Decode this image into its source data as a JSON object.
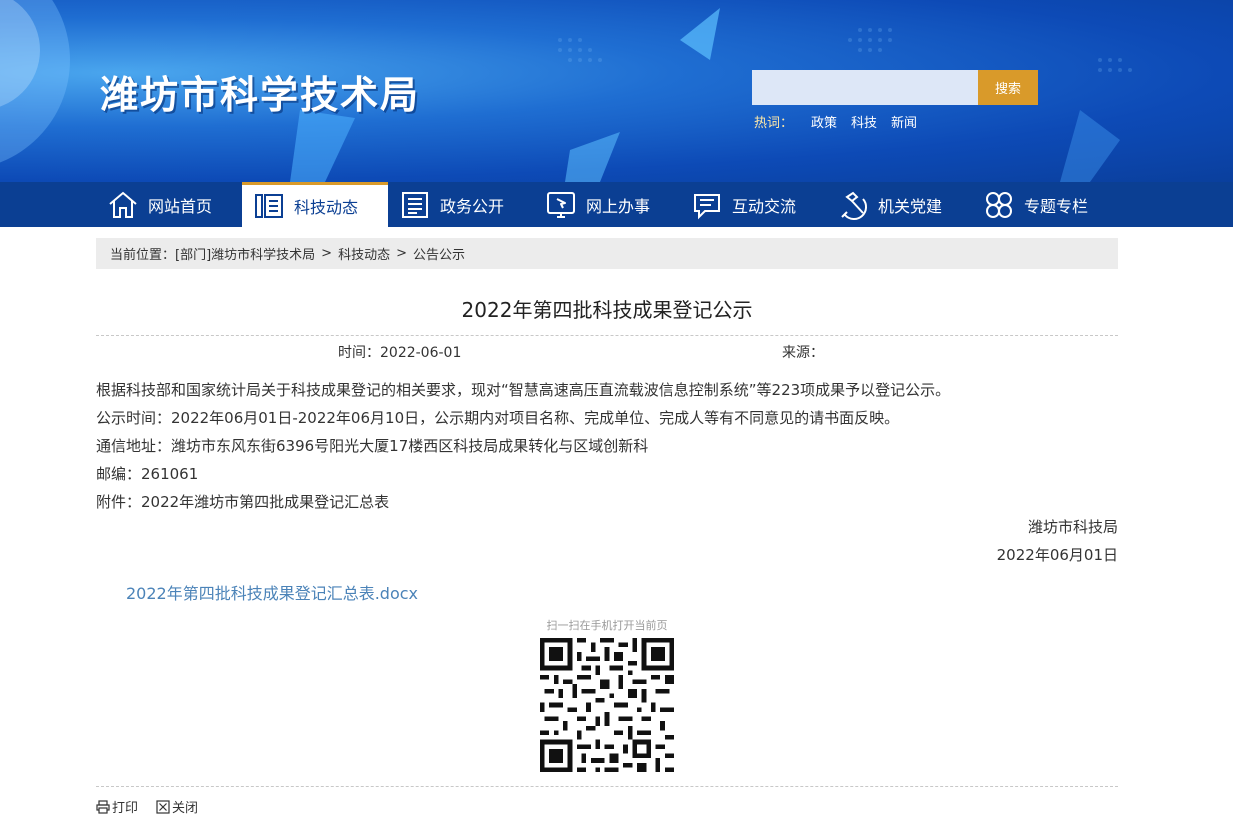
{
  "header": {
    "site_title": "潍坊市科学技术局",
    "search_placeholder": "",
    "search_button": "搜索",
    "hot_label": "热词：",
    "hot_words": [
      "政策",
      "科技",
      "新闻"
    ]
  },
  "nav": {
    "items": [
      {
        "label": "网站首页",
        "icon": "home-icon"
      },
      {
        "label": "科技动态",
        "icon": "news-list-icon",
        "active": true
      },
      {
        "label": "政务公开",
        "icon": "document-icon"
      },
      {
        "label": "网上办事",
        "icon": "monitor-cursor-icon"
      },
      {
        "label": "互动交流",
        "icon": "chat-icon"
      },
      {
        "label": "机关党建",
        "icon": "hammer-sickle-icon"
      },
      {
        "label": "专题专栏",
        "icon": "clover-icon"
      }
    ]
  },
  "breadcrumb": {
    "label": "当前位置：",
    "items": [
      "[部门]潍坊市科学技术局",
      "科技动态",
      "公告公示"
    ],
    "separator": ">"
  },
  "article": {
    "title": "2022年第四批科技成果登记公示",
    "time": "时间：2022-06-01",
    "source": "来源：",
    "paragraphs": [
      "根据科技部和国家统计局关于科技成果登记的相关要求，现对“智慧高速高压直流载波信息控制系统”等223项成果予以登记公示。",
      "公示时间：2022年06月01日-2022年06月10日，公示期内对项目名称、完成单位、完成人等有不同意见的请书面反映。",
      "通信地址：潍坊市东风东街6396号阳光大厦17楼西区科技局成果转化与区域创新科",
      "邮编：261061",
      "附件：2022年潍坊市第四批成果登记汇总表"
    ],
    "signature": "潍坊市科技局",
    "sign_date": "2022年06月01日",
    "attachment_link": "2022年第四批科技成果登记汇总表.docx",
    "qr_caption": "扫一扫在手机打开当前页"
  },
  "tools": {
    "print": "打印",
    "close": "关闭"
  },
  "colors": {
    "nav_bg": "#0b3f93",
    "accent": "#d99a2a",
    "link": "#4b83b8"
  }
}
